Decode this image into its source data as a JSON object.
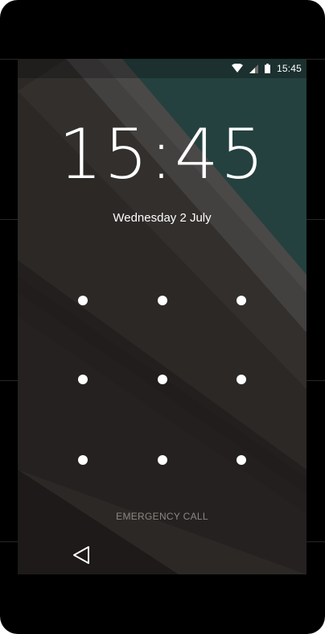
{
  "status_bar": {
    "time": "15:45",
    "icons": [
      "wifi-icon",
      "cell-signal-icon",
      "battery-icon"
    ]
  },
  "lockscreen": {
    "clock": "15:45",
    "date": "Wednesday 2 July",
    "emergency_label": "EMERGENCY CALL",
    "pattern_dot_count": 9
  },
  "nav": {
    "back_icon": "back-triangle-icon"
  },
  "colors": {
    "teal_accent": "#24413f",
    "background": "#2b2826",
    "text": "#ffffff",
    "emergency_text": "#8a8784"
  }
}
